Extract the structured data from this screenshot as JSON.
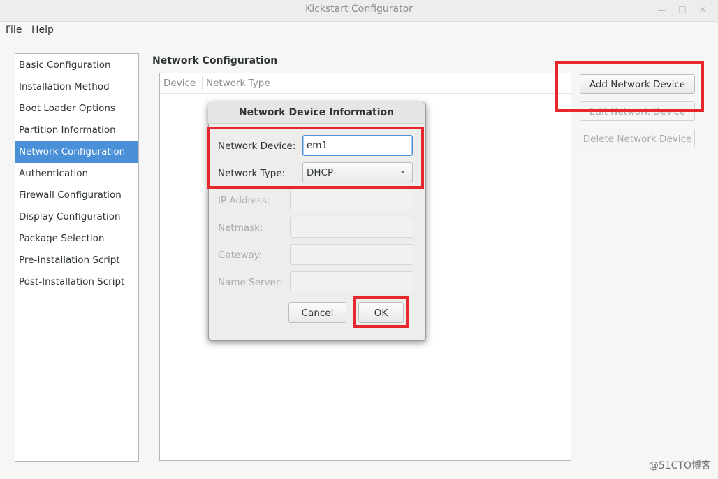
{
  "window": {
    "title": "Kickstart Configurator"
  },
  "menubar": {
    "items": [
      "File",
      "Help"
    ]
  },
  "sidebar": {
    "items": [
      {
        "label": "Basic Configuration"
      },
      {
        "label": "Installation Method"
      },
      {
        "label": "Boot Loader Options"
      },
      {
        "label": "Partition Information"
      },
      {
        "label": "Network Configuration",
        "selected": true
      },
      {
        "label": "Authentication"
      },
      {
        "label": "Firewall Configuration"
      },
      {
        "label": "Display Configuration"
      },
      {
        "label": "Package Selection"
      },
      {
        "label": "Pre-Installation Script"
      },
      {
        "label": "Post-Installation Script"
      }
    ]
  },
  "main": {
    "section_title": "Network Configuration",
    "table_columns": [
      "Device",
      "Network Type"
    ]
  },
  "actions": {
    "add": "Add Network Device",
    "edit": "Edit Network Device",
    "delete": "Delete Network Device"
  },
  "dialog": {
    "title": "Network Device Information",
    "network_device_label": "Network Device:",
    "network_device_value": "em1",
    "network_type_label": "Network Type:",
    "network_type_value": "DHCP",
    "ip_address_label": "IP Address:",
    "netmask_label": "Netmask:",
    "gateway_label": "Gateway:",
    "name_server_label": "Name Server:",
    "cancel": "Cancel",
    "ok": "OK"
  },
  "watermark": "@51CTO博客",
  "colors": {
    "selection": "#4a90d9",
    "highlight_box": "#e4282d"
  }
}
